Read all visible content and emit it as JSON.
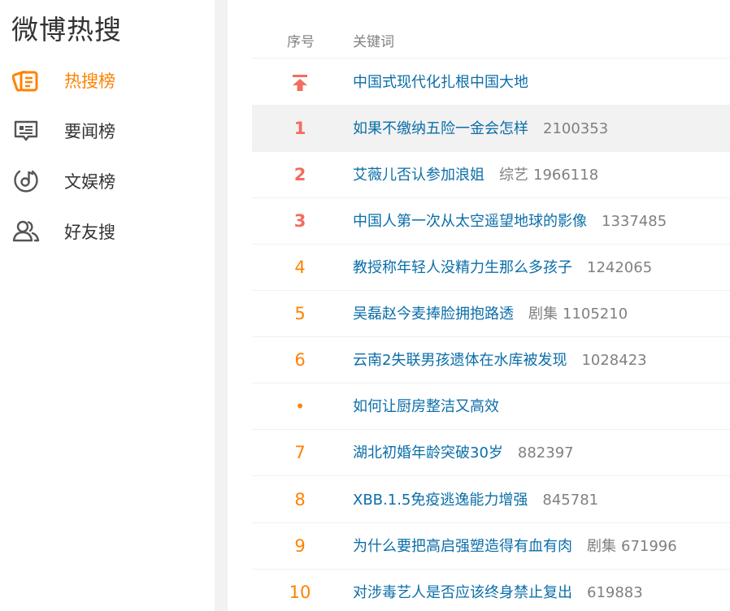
{
  "sidebar": {
    "title": "微博热搜",
    "items": [
      {
        "label": "热搜榜",
        "icon": "hot-list-icon",
        "active": true
      },
      {
        "label": "要闻榜",
        "icon": "news-icon",
        "active": false
      },
      {
        "label": "文娱榜",
        "icon": "music-disc-icon",
        "active": false
      },
      {
        "label": "好友搜",
        "icon": "friends-icon",
        "active": false
      }
    ]
  },
  "table": {
    "col_rank": "序号",
    "col_keyword": "关键词",
    "rows": [
      {
        "rank": "",
        "rank_icon": "pin-top-icon",
        "keyword": "中国式现代化扎根中国大地",
        "tag": "",
        "hot": ""
      },
      {
        "rank": "1",
        "keyword": "如果不缴纳五险一金会怎样",
        "tag": "",
        "hot": "2100353"
      },
      {
        "rank": "2",
        "keyword": "艾薇儿否认参加浪姐",
        "tag": "综艺",
        "hot": "1966118"
      },
      {
        "rank": "3",
        "keyword": "中国人第一次从太空遥望地球的影像",
        "tag": "",
        "hot": "1337485"
      },
      {
        "rank": "4",
        "keyword": "教授称年轻人没精力生那么多孩子",
        "tag": "",
        "hot": "1242065"
      },
      {
        "rank": "5",
        "keyword": "吴磊赵今麦捧脸拥抱路透",
        "tag": "剧集",
        "hot": "1105210"
      },
      {
        "rank": "6",
        "keyword": "云南2失联男孩遗体在水库被发现",
        "tag": "",
        "hot": "1028423"
      },
      {
        "rank": "•",
        "keyword": "如何让厨房整洁又高效",
        "tag": "",
        "hot": ""
      },
      {
        "rank": "7",
        "keyword": "湖北初婚年龄突破30岁",
        "tag": "",
        "hot": "882397"
      },
      {
        "rank": "8",
        "keyword": "XBB.1.5免疫逃逸能力增强",
        "tag": "",
        "hot": "845781"
      },
      {
        "rank": "9",
        "keyword": "为什么要把高启强塑造得有血有肉",
        "tag": "剧集",
        "hot": "671996"
      },
      {
        "rank": "10",
        "keyword": "对涉毒艺人是否应该终身禁止复出",
        "tag": "",
        "hot": "619883"
      }
    ]
  },
  "colors": {
    "accent": "#ff8200",
    "top3": "#f26d5f",
    "link": "#0b6ea8",
    "muted": "#808080",
    "row_highlight": "#f2f2f2"
  }
}
